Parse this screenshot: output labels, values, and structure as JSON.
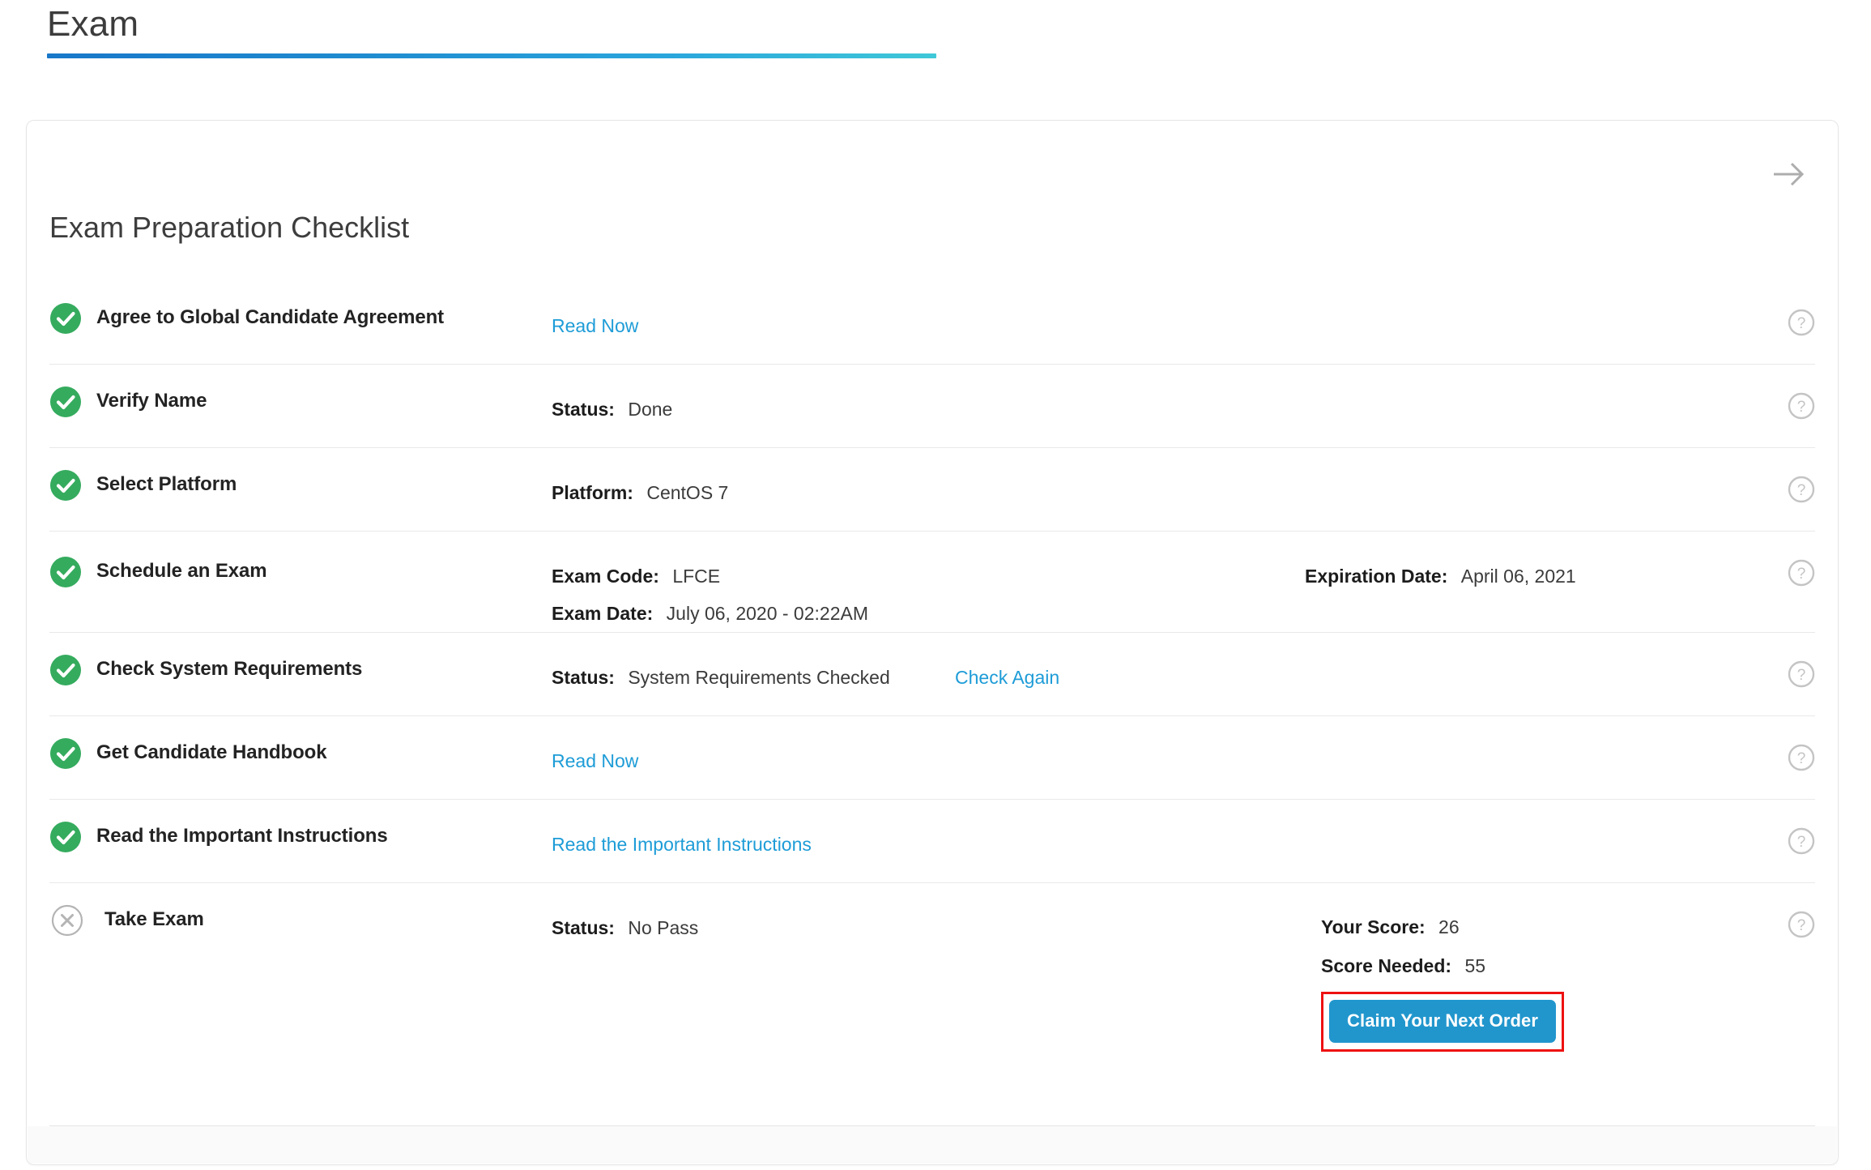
{
  "page": {
    "title": "Exam"
  },
  "card": {
    "next_arrow_icon": "arrow-right-icon",
    "checklist_title": "Exam Preparation Checklist",
    "help_icon": "question-mark-icon",
    "done_icon": "check-circle-icon",
    "fail_icon": "x-circle-icon"
  },
  "colors": {
    "link": "#1e9cd7",
    "done_green": "#35ab5e",
    "fail_grey": "#b4b4b4",
    "button_blue": "#2196cd",
    "highlight_red": "#ee1111",
    "title_gradient_start": "#1877c9",
    "title_gradient_end": "#3fc8d8"
  },
  "items": [
    {
      "label": "Agree to Global Candidate Agreement",
      "state": "done",
      "link": "Read Now"
    },
    {
      "label": "Verify Name",
      "state": "done",
      "status_key": "Status:",
      "status_val": "Done"
    },
    {
      "label": "Select Platform",
      "state": "done",
      "platform_key": "Platform:",
      "platform_val": "CentOS 7"
    },
    {
      "label": "Schedule an Exam",
      "state": "done",
      "exam_code_key": "Exam Code:",
      "exam_code_val": "LFCE",
      "exam_date_key": "Exam Date:",
      "exam_date_val": "July 06, 2020 - 02:22AM",
      "expiration_key": "Expiration Date:",
      "expiration_val": "April 06, 2021"
    },
    {
      "label": "Check System Requirements",
      "state": "done",
      "status_key": "Status:",
      "status_val": "System Requirements Checked",
      "link": "Check Again"
    },
    {
      "label": "Get Candidate Handbook",
      "state": "done",
      "link": "Read Now"
    },
    {
      "label": "Read the Important Instructions",
      "state": "done",
      "link": "Read the Important Instructions"
    },
    {
      "label": "Take Exam",
      "state": "fail",
      "status_key": "Status:",
      "status_val": "No Pass",
      "your_score_key": "Your Score:",
      "your_score_val": "26",
      "score_needed_key": "Score Needed:",
      "score_needed_val": "55",
      "claim_button": "Claim Your Next Order"
    }
  ]
}
